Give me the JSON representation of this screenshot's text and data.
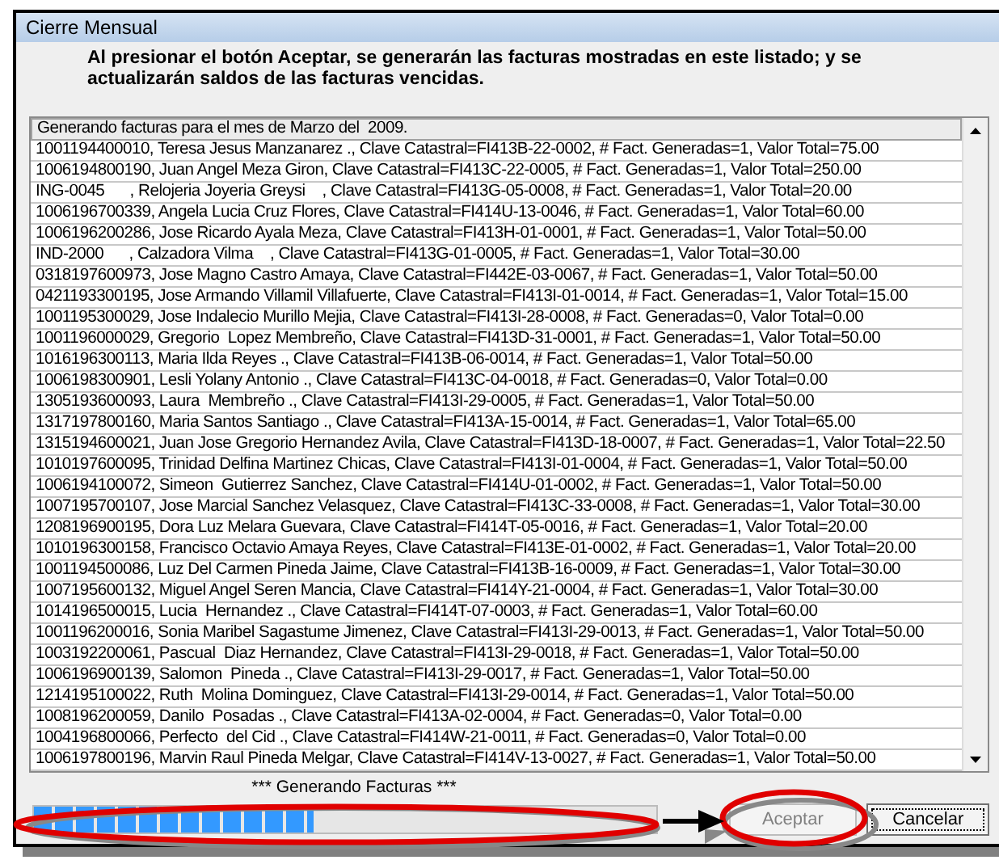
{
  "window": {
    "title": "Cierre Mensual"
  },
  "message": "Al presionar el botón Aceptar, se generarán las facturas mostradas en este listado; y se actualizarán saldos de las facturas vencidas.",
  "list": {
    "items": [
      {
        "text": "Generando facturas para el mes de Marzo del  2009.",
        "selected": true
      },
      {
        "text": "1001194400010, Teresa Jesus Manzanarez ., Clave Catastral=FI413B-22-0002, # Fact. Generadas=1, Valor Total=75.00",
        "selected": false
      },
      {
        "text": "1006194800190, Juan Angel Meza Giron, Clave Catastral=FI413C-22-0005, # Fact. Generadas=1, Valor Total=250.00",
        "selected": false
      },
      {
        "text": "ING-0045      , Relojeria Joyeria Greysi    , Clave Catastral=FI413G-05-0008, # Fact. Generadas=1, Valor Total=20.00",
        "selected": false
      },
      {
        "text": "1006196700339, Angela Lucia Cruz Flores, Clave Catastral=FI414U-13-0046, # Fact. Generadas=1, Valor Total=60.00",
        "selected": false
      },
      {
        "text": "1006196200286, Jose Ricardo Ayala Meza, Clave Catastral=FI413H-01-0001, # Fact. Generadas=1, Valor Total=50.00",
        "selected": false
      },
      {
        "text": "IND-2000      , Calzadora Vilma    , Clave Catastral=FI413G-01-0005, # Fact. Generadas=1, Valor Total=30.00",
        "selected": false
      },
      {
        "text": "0318197600973, Jose Magno Castro Amaya, Clave Catastral=FI442E-03-0067, # Fact. Generadas=1, Valor Total=50.00",
        "selected": false
      },
      {
        "text": "0421193300195, Jose Armando Villamil Villafuerte, Clave Catastral=FI413I-01-0014, # Fact. Generadas=1, Valor Total=15.00",
        "selected": false
      },
      {
        "text": "1001195300029, Jose Indalecio Murillo Mejia, Clave Catastral=FI413I-28-0008, # Fact. Generadas=0, Valor Total=0.00",
        "selected": false
      },
      {
        "text": "1001196000029, Gregorio  Lopez Membreño, Clave Catastral=FI413D-31-0001, # Fact. Generadas=1, Valor Total=50.00",
        "selected": false
      },
      {
        "text": "1016196300113, Maria Ilda Reyes ., Clave Catastral=FI413B-06-0014, # Fact. Generadas=1, Valor Total=50.00",
        "selected": false
      },
      {
        "text": "1006198300901, Lesli Yolany Antonio ., Clave Catastral=FI413C-04-0018, # Fact. Generadas=0, Valor Total=0.00",
        "selected": false
      },
      {
        "text": "1305193600093, Laura  Membreño ., Clave Catastral=FI413I-29-0005, # Fact. Generadas=1, Valor Total=50.00",
        "selected": false
      },
      {
        "text": "1317197800160, Maria Santos Santiago ., Clave Catastral=FI413A-15-0014, # Fact. Generadas=1, Valor Total=65.00",
        "selected": false
      },
      {
        "text": "1315194600021, Juan Jose Gregorio Hernandez Avila, Clave Catastral=FI413D-18-0007, # Fact. Generadas=1, Valor Total=22.50",
        "selected": false
      },
      {
        "text": "1010197600095, Trinidad Delfina Martinez Chicas, Clave Catastral=FI413I-01-0004, # Fact. Generadas=1, Valor Total=50.00",
        "selected": false
      },
      {
        "text": "1006194100072, Simeon  Gutierrez Sanchez, Clave Catastral=FI414U-01-0002, # Fact. Generadas=1, Valor Total=50.00",
        "selected": false
      },
      {
        "text": "1007195700107, Jose Marcial Sanchez Velasquez, Clave Catastral=FI413C-33-0008, # Fact. Generadas=1, Valor Total=30.00",
        "selected": false
      },
      {
        "text": "1208196900195, Dora Luz Melara Guevara, Clave Catastral=FI414T-05-0016, # Fact. Generadas=1, Valor Total=20.00",
        "selected": false
      },
      {
        "text": "1010196300158, Francisco Octavio Amaya Reyes, Clave Catastral=FI413E-01-0002, # Fact. Generadas=1, Valor Total=20.00",
        "selected": false
      },
      {
        "text": "1001194500086, Luz Del Carmen Pineda Jaime, Clave Catastral=FI413B-16-0009, # Fact. Generadas=1, Valor Total=30.00",
        "selected": false
      },
      {
        "text": "1007195600132, Miguel Angel Seren Mancia, Clave Catastral=FI414Y-21-0004, # Fact. Generadas=1, Valor Total=30.00",
        "selected": false
      },
      {
        "text": "1014196500015, Lucia  Hernandez ., Clave Catastral=FI414T-07-0003, # Fact. Generadas=1, Valor Total=60.00",
        "selected": false
      },
      {
        "text": "1001196200016, Sonia Maribel Sagastume Jimenez, Clave Catastral=FI413I-29-0013, # Fact. Generadas=1, Valor Total=50.00",
        "selected": false
      },
      {
        "text": "1003192200061, Pascual  Diaz Hernandez, Clave Catastral=FI413I-29-0018, # Fact. Generadas=1, Valor Total=50.00",
        "selected": false
      },
      {
        "text": "1006196900139, Salomon  Pineda ., Clave Catastral=FI413I-29-0017, # Fact. Generadas=1, Valor Total=50.00",
        "selected": false
      },
      {
        "text": "1214195100022, Ruth  Molina Dominguez, Clave Catastral=FI413I-29-0014, # Fact. Generadas=1, Valor Total=50.00",
        "selected": false
      },
      {
        "text": "1008196200059, Danilo  Posadas ., Clave Catastral=FI413A-02-0004, # Fact. Generadas=0, Valor Total=0.00",
        "selected": false
      },
      {
        "text": "1004196800066, Perfecto  del Cid ., Clave Catastral=FI414W-21-0011, # Fact. Generadas=0, Valor Total=0.00",
        "selected": false
      },
      {
        "text": "1006197800196, Marvin Raul Pineda Melgar, Clave Catastral=FI414V-13-0027, # Fact. Generadas=1, Valor Total=50.00",
        "selected": false
      }
    ]
  },
  "status": "*** Generando Facturas ***",
  "progress": {
    "level": 0.45
  },
  "buttons": [
    {
      "label": "Aceptar",
      "disabled": true
    },
    {
      "label": "Cancelar",
      "disabled": false
    }
  ]
}
